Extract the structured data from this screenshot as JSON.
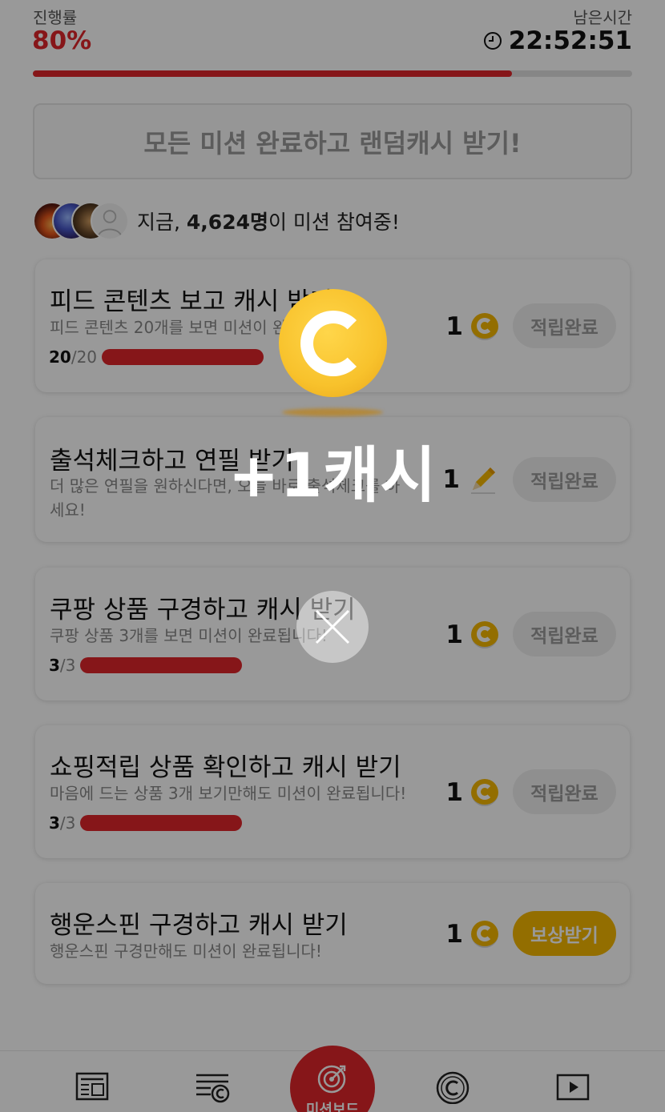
{
  "header": {
    "progress_label": "진행률",
    "progress_value": "80%",
    "progress_fraction": 0.8,
    "remaining_label": "남은시간",
    "remaining_time": "22:52:51"
  },
  "all_mission_button": "모든 미션 완료하고 랜덤캐시 받기!",
  "participants": {
    "prefix": "지금, ",
    "count": "4,624명",
    "suffix": "이 미션 참여중!"
  },
  "missions": [
    {
      "title": "피드 콘텐츠 보고 캐시 받기",
      "desc": "피드 콘텐츠 20개를 보면 미션이 완료됩니다!",
      "progress_current": "20",
      "progress_total": "/20",
      "progress_fraction": 1.0,
      "reward": "1",
      "reward_icon": "coin-icon",
      "button": "적립완료",
      "button_state": "done"
    },
    {
      "title": "출석체크하고 연필 받기",
      "desc": "더 많은 연필을 원하신다면, 오늘 바로 출석체크를 하세요!",
      "reward": "1",
      "reward_icon": "pencil-icon",
      "button": "적립완료",
      "button_state": "done"
    },
    {
      "title": "쿠팡 상품 구경하고 캐시 받기",
      "desc": "쿠팡 상품 3개를 보면 미션이 완료됩니다!",
      "progress_current": "3",
      "progress_total": "/3",
      "progress_fraction": 1.0,
      "reward": "1",
      "reward_icon": "coin-icon",
      "button": "적립완료",
      "button_state": "done"
    },
    {
      "title": "쇼핑적립 상품 확인하고 캐시 받기",
      "desc": "마음에 드는 상품 3개 보기만해도 미션이 완료됩니다!",
      "progress_current": "3",
      "progress_total": "/3",
      "progress_fraction": 1.0,
      "reward": "1",
      "reward_icon": "coin-icon",
      "button": "적립완료",
      "button_state": "done"
    },
    {
      "title": "행운스핀 구경하고 캐시 받기",
      "desc": "행운스핀 구경만해도 미션이 완료됩니다!",
      "reward": "1",
      "reward_icon": "coin-icon",
      "button": "보상받기",
      "button_state": "claim"
    }
  ],
  "bottom_nav": {
    "center_label": "미션보드",
    "items": [
      "feed-icon",
      "list-coin-icon",
      "target-icon",
      "cash-icon",
      "play-icon"
    ]
  },
  "overlay": {
    "reward_text": "+1캐시",
    "icon": "coin-icon",
    "close_icon": "close-icon"
  },
  "colors": {
    "accent": "#e0252a",
    "coin": "#f5b800"
  }
}
